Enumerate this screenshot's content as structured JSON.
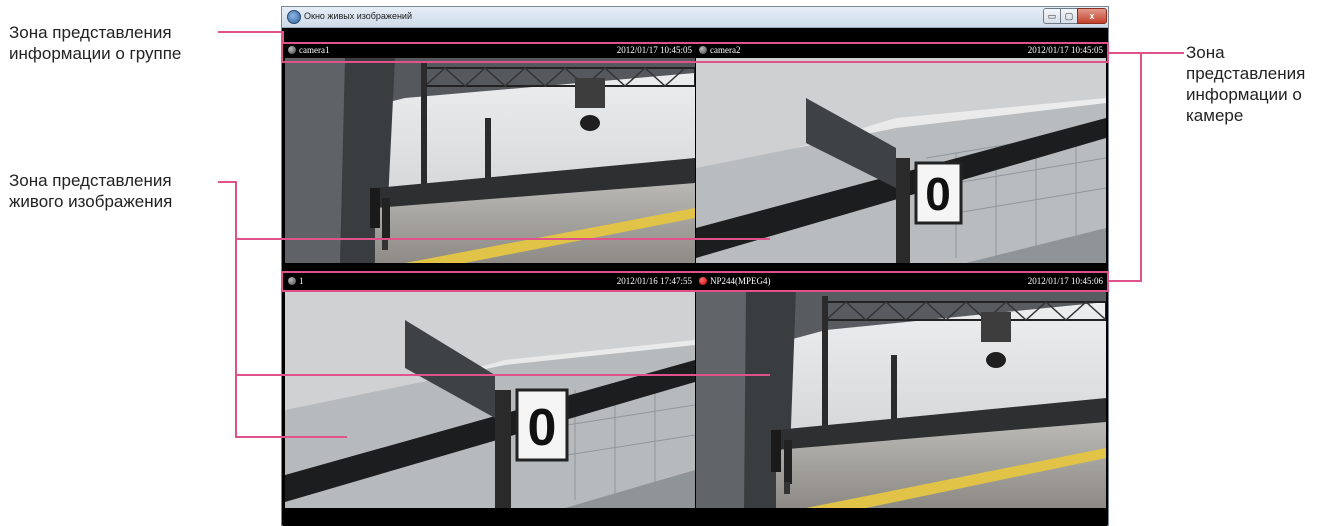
{
  "annotations": {
    "group_info": "Зона представления\nинформации о группе",
    "camera_info": "Зона\nпредставления\nинформации о\nкамере",
    "live_image": "Зона представления\nживого изображения"
  },
  "window": {
    "title": "Окно живых изображений",
    "controls": {
      "minimize": "▭",
      "maximize": "▢",
      "close": "x"
    }
  },
  "cameras": [
    {
      "name": "camera1",
      "timestamp": "2012/01/17 10:45:05",
      "status": "gray"
    },
    {
      "name": "camera2",
      "timestamp": "2012/01/17 10:45:05",
      "status": "gray"
    },
    {
      "name": "1",
      "timestamp": "2012/01/16 17:47:55",
      "status": "gray"
    },
    {
      "name": "NP244(MPEG4)",
      "timestamp": "2012/01/17 10:45:06",
      "status": "red"
    }
  ],
  "tiles": [
    {
      "sign_number": ""
    },
    {
      "sign_number": "0"
    },
    {
      "sign_number": "0"
    },
    {
      "sign_number": ""
    }
  ],
  "colors": {
    "annotation_line": "#e0528a",
    "highlight_box": "#e0528a"
  }
}
